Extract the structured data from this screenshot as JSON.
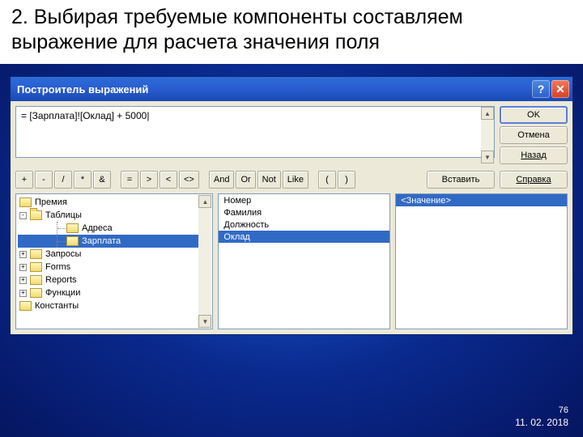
{
  "heading": "2. Выбирая требуемые компоненты составляем выражение для расчета значения поля",
  "window": {
    "title": "Построитель выражений",
    "expression": "= [Зарплата]![Оклад] + 5000|",
    "buttons": {
      "ok": "OK",
      "cancel": "Отмена",
      "back": "Назад",
      "insert": "Вставить",
      "help": "Справка"
    },
    "operators": [
      "+",
      "-",
      "/",
      "*",
      "&",
      "=",
      ">",
      "<",
      "<>",
      "And",
      "Or",
      "Not",
      "Like",
      "(",
      ")"
    ]
  },
  "tree": {
    "items": [
      {
        "label": "Премия",
        "indent": 0,
        "icon": "folder",
        "exp": null
      },
      {
        "label": "Таблицы",
        "indent": 0,
        "icon": "folder-open",
        "exp": "-"
      },
      {
        "label": "Адреса",
        "indent": 2,
        "icon": "folder",
        "exp": null,
        "line": true
      },
      {
        "label": "Зарплата",
        "indent": 2,
        "icon": "folder",
        "exp": null,
        "line": true,
        "selected": true
      },
      {
        "label": "Запросы",
        "indent": 0,
        "icon": "folder",
        "exp": "+"
      },
      {
        "label": "Forms",
        "indent": 0,
        "icon": "folder",
        "exp": "+"
      },
      {
        "label": "Reports",
        "indent": 0,
        "icon": "folder",
        "exp": "+"
      },
      {
        "label": "Функции",
        "indent": 0,
        "icon": "folder",
        "exp": "+"
      },
      {
        "label": "Константы",
        "indent": 0,
        "icon": "folder",
        "exp": null
      }
    ]
  },
  "fields": {
    "items": [
      {
        "label": "Номер",
        "selected": false
      },
      {
        "label": "Фамилия",
        "selected": false
      },
      {
        "label": "Должность",
        "selected": false
      },
      {
        "label": "Оклад",
        "selected": true
      }
    ]
  },
  "values": {
    "items": [
      {
        "label": "<Значение>",
        "selected": true
      }
    ]
  },
  "meta": {
    "page": "76",
    "date": "11. 02. 2018"
  }
}
